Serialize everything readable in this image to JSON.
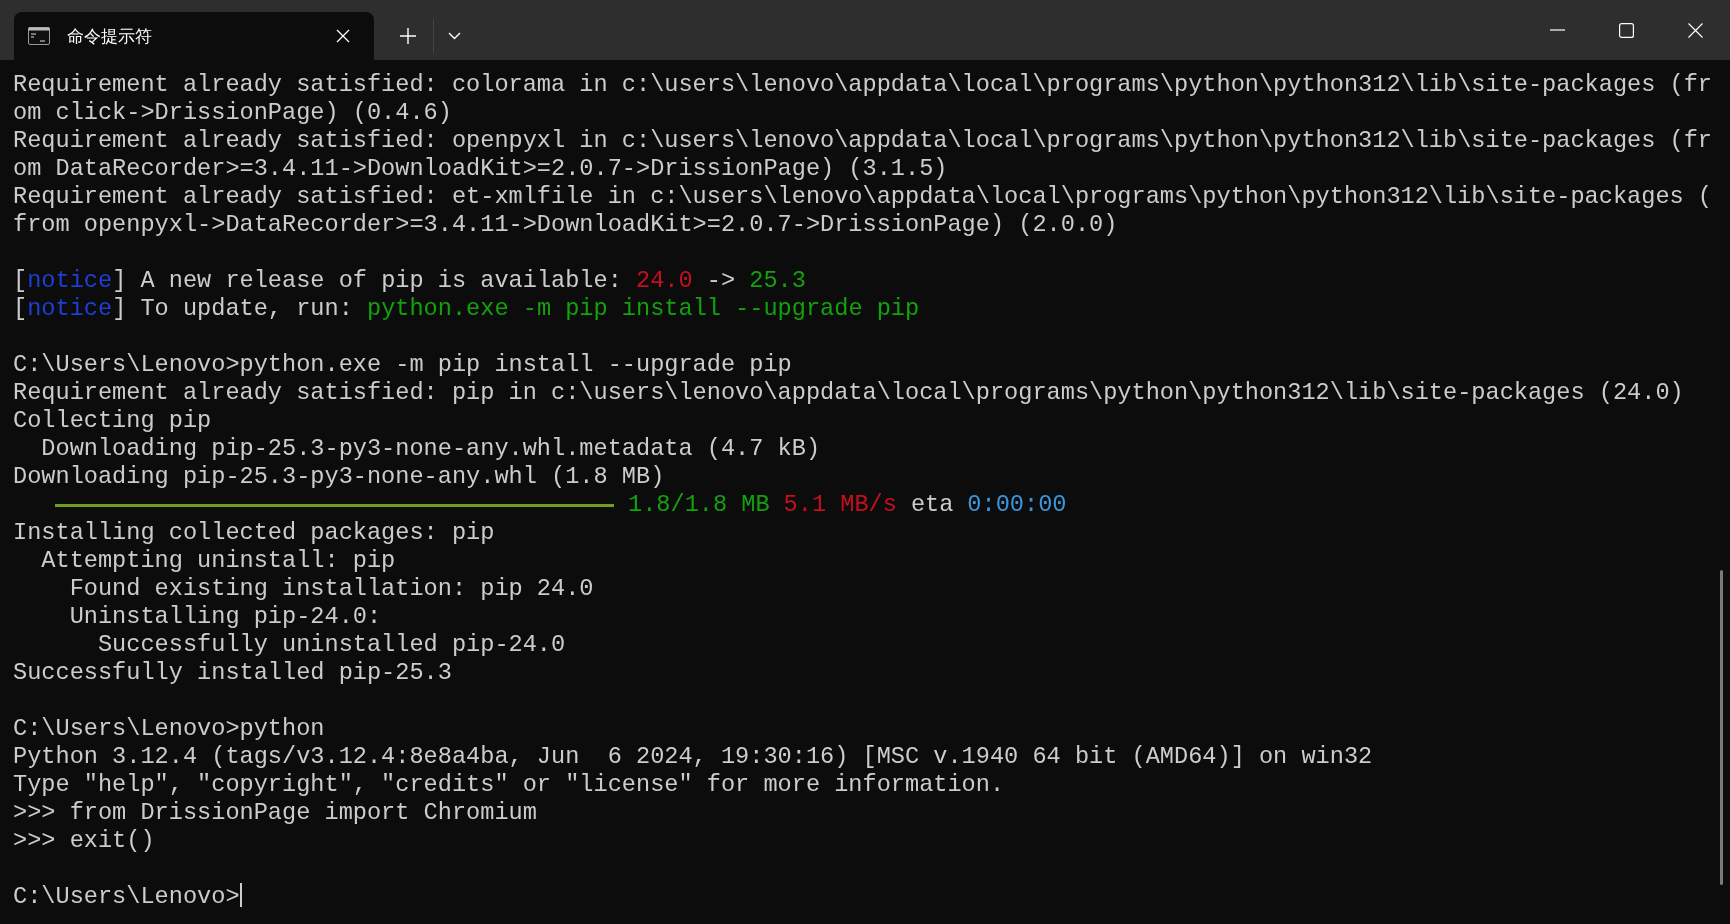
{
  "window": {
    "tab": {
      "title": "命令提示符",
      "selected": true
    }
  },
  "terminal": {
    "lines": [
      {
        "kind": "text",
        "segments": [
          {
            "text": "Requirement already satisfied: colorama in c:\\users\\lenovo\\appdata\\local\\programs\\python\\python312\\lib\\site-packages (fr",
            "color": "#cccccc"
          }
        ]
      },
      {
        "kind": "text",
        "segments": [
          {
            "text": "om click->DrissionPage) (0.4.6)",
            "color": "#cccccc"
          }
        ]
      },
      {
        "kind": "text",
        "segments": [
          {
            "text": "Requirement already satisfied: openpyxl in c:\\users\\lenovo\\appdata\\local\\programs\\python\\python312\\lib\\site-packages (fr",
            "color": "#cccccc"
          }
        ]
      },
      {
        "kind": "text",
        "segments": [
          {
            "text": "om DataRecorder>=3.4.11->DownloadKit>=2.0.7->DrissionPage) (3.1.5)",
            "color": "#cccccc"
          }
        ]
      },
      {
        "kind": "text",
        "segments": [
          {
            "text": "Requirement already satisfied: et-xmlfile in c:\\users\\lenovo\\appdata\\local\\programs\\python\\python312\\lib\\site-packages (",
            "color": "#cccccc"
          }
        ]
      },
      {
        "kind": "text",
        "segments": [
          {
            "text": "from openpyxl->DataRecorder>=3.4.11->DownloadKit>=2.0.7->DrissionPage) (2.0.0)",
            "color": "#cccccc"
          }
        ]
      },
      {
        "kind": "blank"
      },
      {
        "kind": "text",
        "segments": [
          {
            "text": "[",
            "color": "#cccccc"
          },
          {
            "text": "notice",
            "color": "#1d3fd6"
          },
          {
            "text": "] A new release of pip is available: ",
            "color": "#cccccc"
          },
          {
            "text": "24.0",
            "color": "#c50f1f"
          },
          {
            "text": " -> ",
            "color": "#cccccc"
          },
          {
            "text": "25.3",
            "color": "#13a10e"
          }
        ]
      },
      {
        "kind": "text",
        "segments": [
          {
            "text": "[",
            "color": "#cccccc"
          },
          {
            "text": "notice",
            "color": "#1d3fd6"
          },
          {
            "text": "] To update, run: ",
            "color": "#cccccc"
          },
          {
            "text": "python.exe -m pip install --upgrade pip",
            "color": "#13a10e"
          }
        ]
      },
      {
        "kind": "blank"
      },
      {
        "kind": "text",
        "segments": [
          {
            "text": "C:\\Users\\Lenovo>python.exe -m pip install --upgrade pip",
            "color": "#cccccc"
          }
        ]
      },
      {
        "kind": "text",
        "segments": [
          {
            "text": "Requirement already satisfied: pip in c:\\users\\lenovo\\appdata\\local\\programs\\python\\python312\\lib\\site-packages (24.0)",
            "color": "#cccccc"
          }
        ]
      },
      {
        "kind": "text",
        "segments": [
          {
            "text": "Collecting pip",
            "color": "#cccccc"
          }
        ]
      },
      {
        "kind": "text",
        "segments": [
          {
            "text": "  Downloading pip-25.3-py3-none-any.whl.metadata (4.7 kB)",
            "color": "#cccccc"
          }
        ]
      },
      {
        "kind": "text",
        "segments": [
          {
            "text": "Downloading pip-25.3-py3-none-any.whl (1.8 MB)",
            "color": "#cccccc"
          }
        ]
      },
      {
        "kind": "progress",
        "level": 1,
        "segments": [
          {
            "text": "1.8/1.8 MB",
            "color": "#13a10e"
          },
          {
            "text": "5.1 MB/s",
            "color": "#c50f1f"
          },
          {
            "text": "eta",
            "color": "#cccccc"
          },
          {
            "text": "0:00:00",
            "color": "#3a96dd"
          }
        ]
      },
      {
        "kind": "text",
        "segments": [
          {
            "text": "Installing collected packages: pip",
            "color": "#cccccc"
          }
        ]
      },
      {
        "kind": "text",
        "segments": [
          {
            "text": "  Attempting uninstall: pip",
            "color": "#cccccc"
          }
        ]
      },
      {
        "kind": "text",
        "segments": [
          {
            "text": "    Found existing installation: pip 24.0",
            "color": "#cccccc"
          }
        ]
      },
      {
        "kind": "text",
        "segments": [
          {
            "text": "    Uninstalling pip-24.0:",
            "color": "#cccccc"
          }
        ]
      },
      {
        "kind": "text",
        "segments": [
          {
            "text": "      Successfully uninstalled pip-24.0",
            "color": "#cccccc"
          }
        ]
      },
      {
        "kind": "text",
        "segments": [
          {
            "text": "Successfully installed pip-25.3",
            "color": "#cccccc"
          }
        ]
      },
      {
        "kind": "blank"
      },
      {
        "kind": "text",
        "segments": [
          {
            "text": "C:\\Users\\Lenovo>python",
            "color": "#cccccc"
          }
        ]
      },
      {
        "kind": "text",
        "segments": [
          {
            "text": "Python 3.12.4 (tags/v3.12.4:8e8a4ba, Jun  6 2024, 19:30:16) [MSC v.1940 64 bit (AMD64)] on win32",
            "color": "#cccccc"
          }
        ]
      },
      {
        "kind": "text",
        "segments": [
          {
            "text": "Type \"help\", \"copyright\", \"credits\" or \"license\" for more information.",
            "color": "#cccccc"
          }
        ]
      },
      {
        "kind": "text",
        "segments": [
          {
            "text": ">>> from DrissionPage import Chromium",
            "color": "#cccccc"
          }
        ]
      },
      {
        "kind": "text",
        "segments": [
          {
            "text": ">>> exit()",
            "color": "#cccccc"
          }
        ]
      },
      {
        "kind": "blank"
      },
      {
        "kind": "prompt",
        "segments": [
          {
            "text": "C:\\Users\\Lenovo>",
            "color": "#cccccc"
          }
        ]
      }
    ]
  }
}
